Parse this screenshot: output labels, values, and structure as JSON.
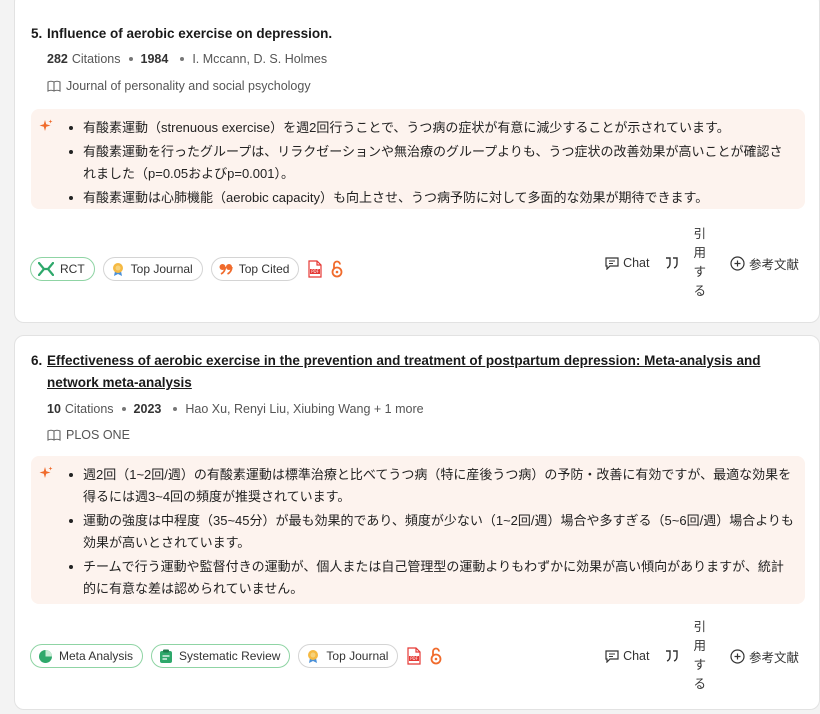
{
  "papers": [
    {
      "number": "5.",
      "title": "Influence of aerobic exercise on depression.",
      "citations_count": "282",
      "citations_label": "Citations",
      "year": "1984",
      "authors": "I. Mccann, D. S. Holmes",
      "journal": "Journal of personality and social psychology",
      "summary": [
        "有酸素運動（strenuous exercise）を週2回行うことで、うつ病の症状が有意に減少することが示されています。",
        "有酸素運動を行ったグループは、リラクゼーションや無治療のグループよりも、うつ症状の改善効果が高いことが確認されました（p=0.05およびp=0.001）。",
        "有酸素運動は心肺機能（aerobic capacity）も向上させ、うつ病予防に対して多面的な効果が期待できます。"
      ],
      "tags": [
        "RCT",
        "Top Journal",
        "Top Cited"
      ]
    },
    {
      "number": "6.",
      "title": "Effectiveness of aerobic exercise in the prevention and treatment of postpartum depression: Meta-analysis and network meta-analysis",
      "citations_count": "10",
      "citations_label": "Citations",
      "year": "2023",
      "authors": "Hao Xu, Renyi Liu, Xiubing Wang + 1 more",
      "journal": "PLOS ONE",
      "summary": [
        "週2回（1~2回/週）の有酸素運動は標準治療と比べてうつ病（特に産後うつ病）の予防・改善に有効ですが、最適な効果を得るには週3~4回の頻度が推奨されています。",
        "運動の強度は中程度（35~45分）が最も効果的であり、頻度が少ない（1~2回/週）場合や多すぎる（5~6回/週）場合よりも効果が高いとされています。",
        "チームで行う運動や監督付きの運動が、個人または自己管理型の運動よりもわずかに効果が高い傾向がありますが、統計的に有意な差は認められていません。"
      ],
      "tags": [
        "Meta Analysis",
        "Systematic Review",
        "Top Journal"
      ]
    }
  ],
  "actions": {
    "chat": "Chat",
    "cite_chars": [
      "引",
      "用",
      "す",
      "る"
    ],
    "references": "参考文献"
  },
  "icons": {
    "summary": "sparkle-icon",
    "journal": "book-icon",
    "pdf": "pdf-icon",
    "open_access": "open-access-lock-icon",
    "chat": "chat-icon",
    "cite": "quote-icon",
    "references": "add-circle-icon"
  },
  "colors": {
    "accent": "#f06b2c",
    "summary_bg": "#fdf3ee",
    "rct_green": "#2ea86b",
    "tag_green_border": "#8fd4a4",
    "pdf_red": "#e53935"
  }
}
